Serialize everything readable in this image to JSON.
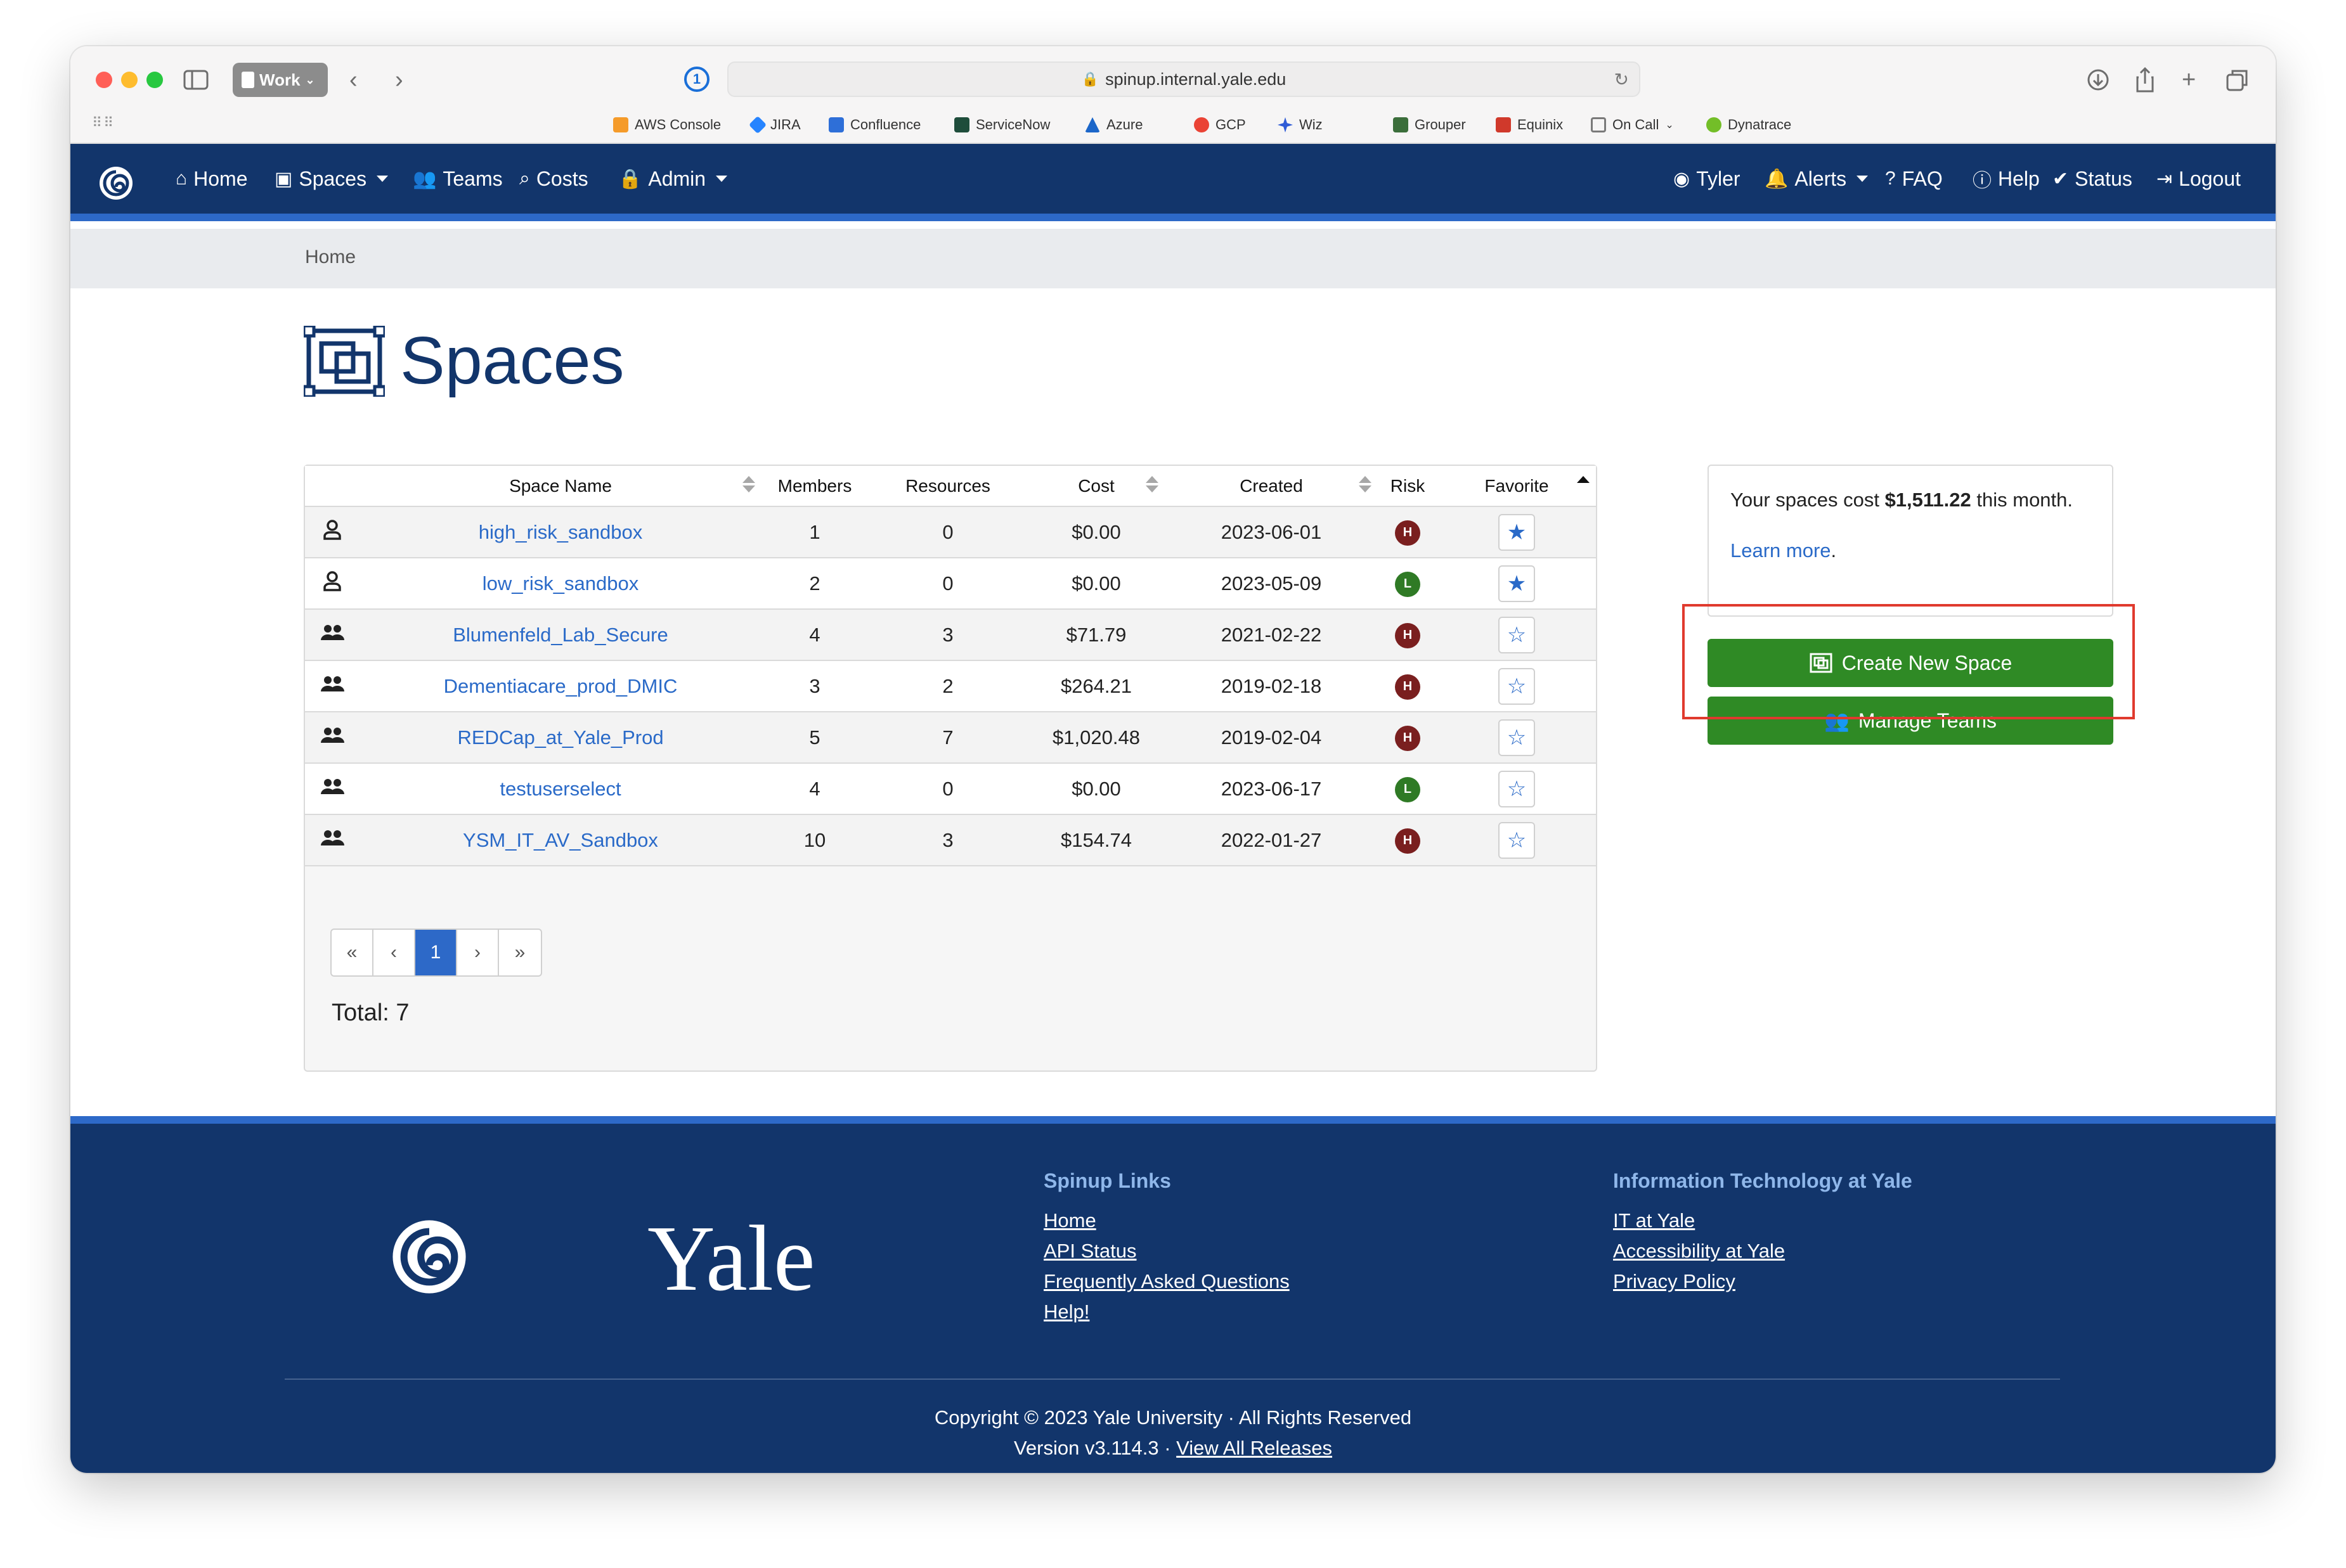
{
  "browser": {
    "profile": "Work",
    "url": "spinup.internal.yale.edu",
    "bookmarks": [
      {
        "label": "AWS Console",
        "color": "#f59b2a"
      },
      {
        "label": "JIRA",
        "color": "#2684ff"
      },
      {
        "label": "Confluence",
        "color": "#2e6fd8"
      },
      {
        "label": "ServiceNow",
        "color": "#1e4d3b"
      },
      {
        "label": "Azure",
        "color": "#1b66c9"
      },
      {
        "label": "GCP",
        "color": "#ea4335"
      },
      {
        "label": "Wiz",
        "color": "#2f5bd6"
      },
      {
        "label": "Grouper",
        "color": "#3b6e3b"
      },
      {
        "label": "Equinix",
        "color": "#d0392b"
      },
      {
        "label": "On Call",
        "color": "#7a7a7a"
      },
      {
        "label": "Dynatrace",
        "color": "#73be28"
      }
    ]
  },
  "nav": {
    "home": "Home",
    "spaces": "Spaces",
    "teams": "Teams",
    "costs": "Costs",
    "admin": "Admin",
    "user": "Tyler",
    "alerts": "Alerts",
    "faq": "FAQ",
    "help": "Help",
    "status": "Status",
    "logout": "Logout"
  },
  "breadcrumb": "Home",
  "page": {
    "title": "Spaces"
  },
  "table": {
    "headers": {
      "name": "Space Name",
      "members": "Members",
      "resources": "Resources",
      "cost": "Cost",
      "created": "Created",
      "risk": "Risk",
      "favorite": "Favorite"
    },
    "rows": [
      {
        "type": "user-icon",
        "name": "high_risk_sandbox",
        "members": "1",
        "resources": "0",
        "cost": "$0.00",
        "created": "2023-06-01",
        "risk": "H",
        "favorite": true
      },
      {
        "type": "user-icon",
        "name": "low_risk_sandbox",
        "members": "2",
        "resources": "0",
        "cost": "$0.00",
        "created": "2023-05-09",
        "risk": "L",
        "favorite": true
      },
      {
        "type": "users-icon",
        "name": "Blumenfeld_Lab_Secure",
        "members": "4",
        "resources": "3",
        "cost": "$71.79",
        "created": "2021-02-22",
        "risk": "H",
        "favorite": false
      },
      {
        "type": "users-icon",
        "name": "Dementiacare_prod_DMIC",
        "members": "3",
        "resources": "2",
        "cost": "$264.21",
        "created": "2019-02-18",
        "risk": "H",
        "favorite": false
      },
      {
        "type": "users-icon",
        "name": "REDCap_at_Yale_Prod",
        "members": "5",
        "resources": "7",
        "cost": "$1,020.48",
        "created": "2019-02-04",
        "risk": "H",
        "favorite": false
      },
      {
        "type": "users-icon",
        "name": "testuserselect",
        "members": "4",
        "resources": "0",
        "cost": "$0.00",
        "created": "2023-06-17",
        "risk": "L",
        "favorite": false
      },
      {
        "type": "users-icon",
        "name": "YSM_IT_AV_Sandbox",
        "members": "10",
        "resources": "3",
        "cost": "$154.74",
        "created": "2022-01-27",
        "risk": "H",
        "favorite": false
      }
    ]
  },
  "pagination": {
    "first": "«",
    "prev": "‹",
    "current": "1",
    "next": "›",
    "last": "»"
  },
  "total": "Total: 7",
  "sidebar": {
    "cost_prefix": "Your spaces cost",
    "cost_amount": "$1,511.22",
    "cost_suffix": "this month.",
    "learn_more": "Learn more",
    "create_button": "Create New Space",
    "manage_button": "Manage Teams"
  },
  "colors": {
    "navy": "#12356b",
    "accent_blue": "#2d69c8",
    "link": "#2a6ac8",
    "green_button": "#2f8a25",
    "risk_high": "#7a1f1f",
    "risk_low": "#2f7a25",
    "highlight": "#e03a2e"
  },
  "footer": {
    "wordmark": "Yale",
    "col1_title": "Spinup Links",
    "col1_links": [
      "Home",
      "API Status",
      "Frequently Asked Questions",
      "Help!"
    ],
    "col2_title": "Information Technology at Yale",
    "col2_links": [
      "IT at Yale",
      "Accessibility at Yale",
      "Privacy Policy"
    ],
    "copyright": "Copyright © 2023 Yale University · All Rights Reserved",
    "version": "Version v3.114.3 ·",
    "releases": "View All Releases"
  }
}
